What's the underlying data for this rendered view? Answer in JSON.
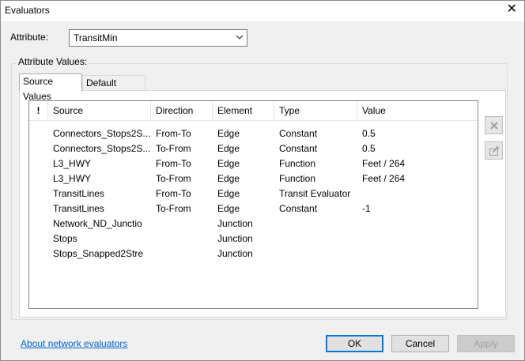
{
  "window": {
    "title": "Evaluators",
    "close_glyph": "✕"
  },
  "attribute": {
    "label": "Attribute:",
    "selected": "TransitMin"
  },
  "group": {
    "label": "Attribute Values:"
  },
  "tabs": [
    {
      "label": "Source Values",
      "active": true
    },
    {
      "label": "Default Values",
      "active": false
    }
  ],
  "table": {
    "columns": [
      "!",
      "Source",
      "Direction",
      "Element",
      "Type",
      "Value"
    ],
    "rows": [
      {
        "source": "Connectors_Stops2S...",
        "direction": "From-To",
        "element": "Edge",
        "type": "Constant",
        "value": "0.5"
      },
      {
        "source": "Connectors_Stops2S...",
        "direction": "To-From",
        "element": "Edge",
        "type": "Constant",
        "value": "0.5"
      },
      {
        "source": "L3_HWY",
        "direction": "From-To",
        "element": "Edge",
        "type": "Function",
        "value": "Feet / 264"
      },
      {
        "source": "L3_HWY",
        "direction": "To-From",
        "element": "Edge",
        "type": "Function",
        "value": "Feet / 264"
      },
      {
        "source": "TransitLines",
        "direction": "From-To",
        "element": "Edge",
        "type": "Transit Evaluator",
        "value": ""
      },
      {
        "source": "TransitLines",
        "direction": "To-From",
        "element": "Edge",
        "type": "Constant",
        "value": "-1"
      },
      {
        "source": "Network_ND_Junctio",
        "direction": "",
        "element": "Junction",
        "type": "",
        "value": ""
      },
      {
        "source": "Stops",
        "direction": "",
        "element": "Junction",
        "type": "",
        "value": ""
      },
      {
        "source": "Stops_Snapped2Stre",
        "direction": "",
        "element": "Junction",
        "type": "",
        "value": ""
      }
    ]
  },
  "side_buttons": [
    {
      "icon": "delete-x-icon",
      "enabled": false
    },
    {
      "icon": "properties-icon",
      "enabled": false
    }
  ],
  "footer": {
    "link": "About network evaluators",
    "ok": "OK",
    "cancel": "Cancel",
    "apply": "Apply"
  },
  "colors": {
    "accent": "#0078d7",
    "link": "#0066cc"
  }
}
